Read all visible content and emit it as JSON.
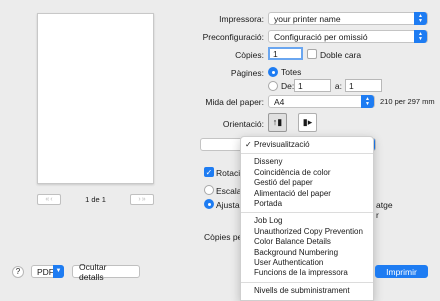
{
  "preview": {
    "page_counter": "1 de 1"
  },
  "printer": {
    "label": "Impressora:",
    "value": "your printer name"
  },
  "preset": {
    "label": "Preconfiguració:",
    "value": "Configuració per omissió"
  },
  "copies": {
    "label": "Còpies:",
    "value": "1",
    "duplex_label": "Doble cara"
  },
  "pages": {
    "label": "Pàgines:",
    "all_label": "Totes",
    "from_label": "De:",
    "from_value": "1",
    "to_label": "a:",
    "to_value": "1"
  },
  "paper_size": {
    "label": "Mida del paper:",
    "value": "A4",
    "dimensions": "210 per 297 mm"
  },
  "orientation": {
    "label": "Orientació:"
  },
  "behind_menu": {
    "rotate_label": "Rotació",
    "scale_label": "Escala:",
    "fit_label": "Ajustar",
    "right_fragment_1": "atge",
    "right_fragment_2": "r",
    "copies_per_label": "Còpies pe"
  },
  "menu": {
    "items": [
      {
        "label": "Previsualització",
        "checked": "✓"
      },
      {
        "label": "Disseny"
      },
      {
        "label": "Coincidència de color"
      },
      {
        "label": "Gestió del paper"
      },
      {
        "label": "Alimentació del paper"
      },
      {
        "label": "Portada"
      },
      {
        "label": "Job Log"
      },
      {
        "label": "Unauthorized Copy Prevention"
      },
      {
        "label": "Color Balance Details"
      },
      {
        "label": "Background Numbering"
      },
      {
        "label": "User Authentication"
      },
      {
        "label": "Funcions de la impressora"
      },
      {
        "label": "Nivells de subministrament"
      }
    ]
  },
  "footer": {
    "help": "?",
    "pdf_label": "PDF",
    "hide_details_label": "Ocultar detalls",
    "print_label": "Imprimir"
  },
  "colors": {
    "accent": "#1e7cf2",
    "background": "#ececec"
  }
}
